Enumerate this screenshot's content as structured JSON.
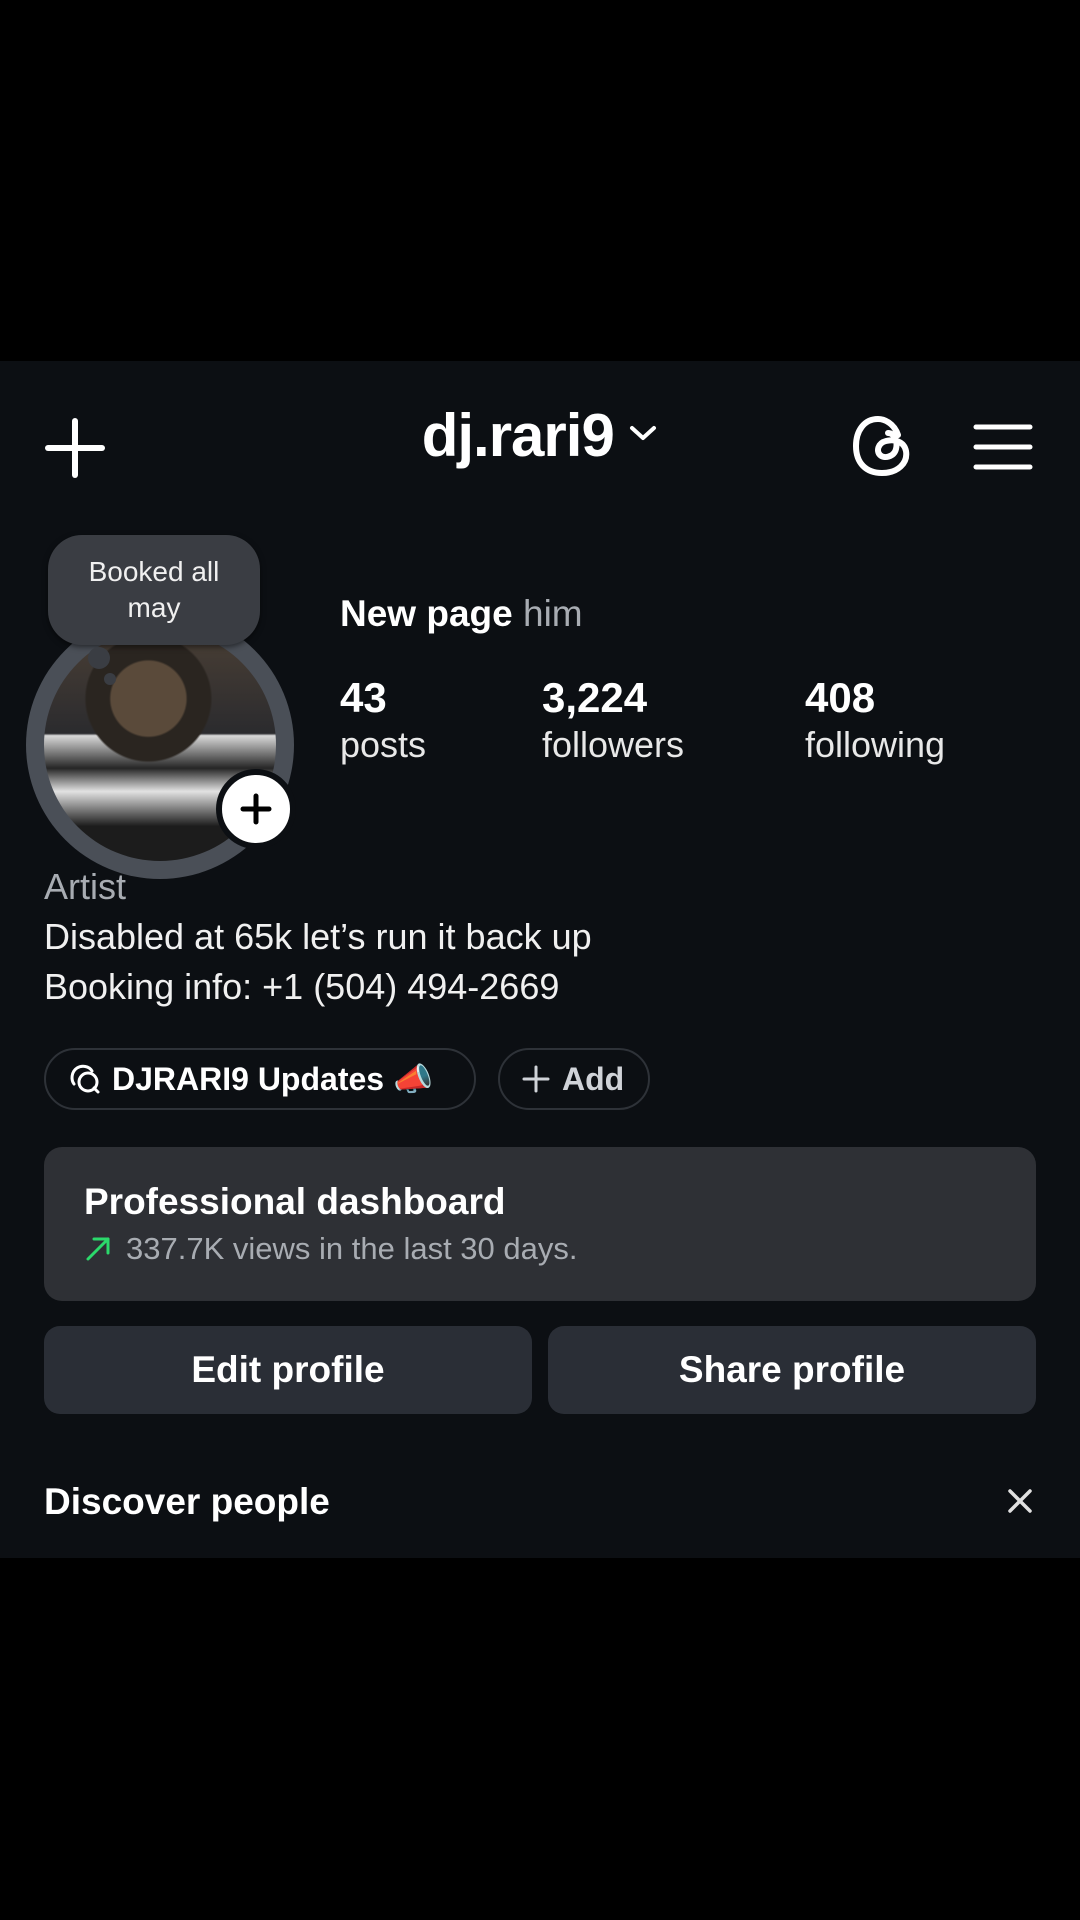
{
  "header": {
    "username": "dj.rari9",
    "icons": [
      "plus-icon",
      "chevron-down-icon",
      "threads-icon",
      "hamburger-menu-icon"
    ]
  },
  "note": {
    "text": "Booked all may"
  },
  "profile": {
    "name": "New page",
    "pronouns": "him",
    "stats": [
      {
        "value": "43",
        "label": "posts"
      },
      {
        "value": "3,224",
        "label": "followers"
      },
      {
        "value": "408",
        "label": "following"
      }
    ],
    "category": "Artist",
    "bio_line1": "Disabled at 65k let’s run it back up",
    "bio_line2": "Booking info: +1 (504) 494-2669"
  },
  "channels": {
    "channel_label": "DJRARI9 Updates 📣",
    "add_label": "Add"
  },
  "dashboard": {
    "title": "Professional dashboard",
    "subtitle": "337.7K views in the last 30 days.",
    "trend_color": "#2bd96b"
  },
  "actions": {
    "edit_label": "Edit profile",
    "share_label": "Share profile"
  },
  "discover": {
    "title": "Discover people"
  }
}
